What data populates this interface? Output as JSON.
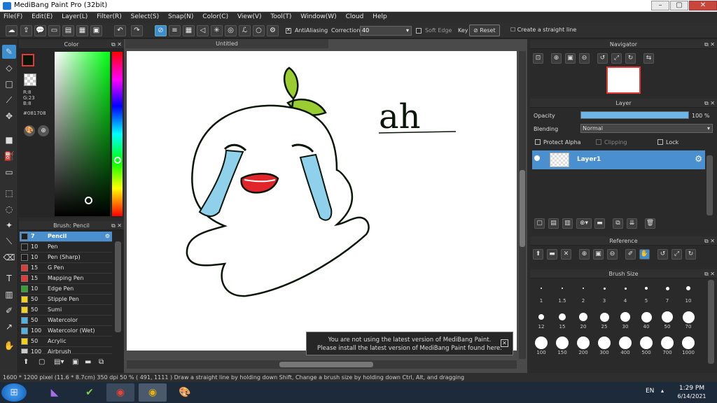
{
  "window": {
    "title": "MediBang Paint Pro (32bit)",
    "minimize": "–",
    "maximize": "▢",
    "close": "✕"
  },
  "menu": [
    "File(F)",
    "Edit(E)",
    "Layer(L)",
    "Filter(R)",
    "Select(S)",
    "Snap(N)",
    "Color(C)",
    "View(V)",
    "Tool(T)",
    "Window(W)",
    "Cloud",
    "Help"
  ],
  "toolbar": {
    "antialiasing_label": "AntiAliasing",
    "correction_label": "Correction",
    "correction_value": "40",
    "softedge_label": "Soft Edge",
    "key_label": "Key",
    "reset_label": "Reset",
    "straight_line_label": "Create a straight line"
  },
  "color_panel": {
    "title": "Color",
    "r": "R:8",
    "g": "G:23",
    "b": "B:8",
    "hex": "#081708"
  },
  "brush_panel": {
    "title": "Brush: Pencil",
    "items": [
      {
        "size": "7",
        "name": "Pencil",
        "color": "#1e1e1e"
      },
      {
        "size": "10",
        "name": "Pen",
        "color": "#1e1e1e"
      },
      {
        "size": "10",
        "name": "Pen (Sharp)",
        "color": "#1e1e1e"
      },
      {
        "size": "15",
        "name": "G Pen",
        "color": "#e53935"
      },
      {
        "size": "15",
        "name": "Mapping Pen",
        "color": "#e53935"
      },
      {
        "size": "10",
        "name": "Edge Pen",
        "color": "#2ea62e"
      },
      {
        "size": "50",
        "name": "Stipple Pen",
        "color": "#f2d21b"
      },
      {
        "size": "50",
        "name": "Sumi",
        "color": "#f2d21b"
      },
      {
        "size": "50",
        "name": "Watercolor",
        "color": "#4fb3e6"
      },
      {
        "size": "100",
        "name": "Watercolor (Wet)",
        "color": "#4fb3e6"
      },
      {
        "size": "50",
        "name": "Acrylic",
        "color": "#f2d21b"
      },
      {
        "size": "100",
        "name": "Airbrush",
        "color": "#cccccc"
      }
    ]
  },
  "document": {
    "tab": "Untitled",
    "text": "ah"
  },
  "notification": {
    "line1": "You are not using the latest version of MediBang Paint.",
    "line2": "Please install the latest version of MediBang Paint found here."
  },
  "navigator": {
    "title": "Navigator"
  },
  "layer_panel": {
    "title": "Layer",
    "opacity_label": "Opacity",
    "opacity_value": "100 %",
    "opacity_fraction": 1.0,
    "blending_label": "Blending",
    "blending_value": "Normal",
    "protect_alpha": "Protect Alpha",
    "clipping": "Clipping",
    "lock": "Lock",
    "layer_name": "Layer1"
  },
  "reference": {
    "title": "Reference"
  },
  "brush_size": {
    "title": "Brush Size",
    "sizes": [
      "1",
      "1.5",
      "2",
      "3",
      "4",
      "5",
      "7",
      "10",
      "12",
      "15",
      "20",
      "25",
      "30",
      "40",
      "50",
      "70",
      "100",
      "150",
      "200",
      "300",
      "400",
      "500",
      "700",
      "1000"
    ]
  },
  "statusbar": "1600 * 1200 pixel   (11.6 * 8.7cm)  350 dpi   50 %   ( 491, 1111 )   Draw a straight line by holding down Shift, Change a brush size by holding down Ctrl, Alt, and dragging",
  "taskbar": {
    "lang": "EN",
    "time": "1:29 PM",
    "date": "6/14/2021"
  },
  "colors": {
    "accent": "#3c8ecf",
    "primary_color": "#081708"
  }
}
